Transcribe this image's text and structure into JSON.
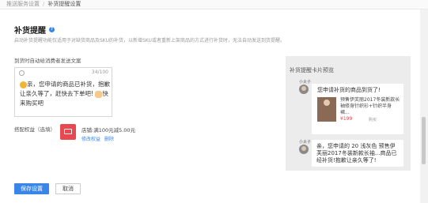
{
  "breadcrumb": {
    "parent": "推送服务设置",
    "separator": "/",
    "current": "补货提醒设置"
  },
  "page": {
    "title": "补货提醒",
    "description": "启动补货提醒功能仅适用于对缺货商品及SKU的补货，以新增SKU或者重新上架商品的方式进行补货时，无法自动发送到货提醒。"
  },
  "message": {
    "label": "到货时自动给消费者发送文案",
    "counter": "34/100",
    "text_part1": "亲，您申请的商品已补货，抱歉让亲久等了，赶快去下单吧!",
    "text_part2": "快来购买吧"
  },
  "coupon": {
    "label": "搭配权益（选填）",
    "text": "店铺:满100元减5.00元",
    "change_label": "修改权益",
    "delete_label": "删除"
  },
  "buttons": {
    "save_label": "保存设置",
    "cancel_label": "取消"
  },
  "preview": {
    "title": "补货提醒卡片预览",
    "shop_name": "小太子",
    "bubble1_text": "您申请补货的商品到货了!",
    "product_title": "预售伊芙丽2017冬装新款长袖修身针织衫+针织半身裙...",
    "product_price": "¥199",
    "product_tag": "购买",
    "bubble2_text": "亲，您申请的 20 浅灰色 预售伊芙丽2017冬装新款长袖...商品已经补货!抱歉让亲久等了!"
  },
  "colors": {
    "accent": "#3a86e8",
    "coupon_red": "#e8484f",
    "preview_bg": "#ececec"
  }
}
